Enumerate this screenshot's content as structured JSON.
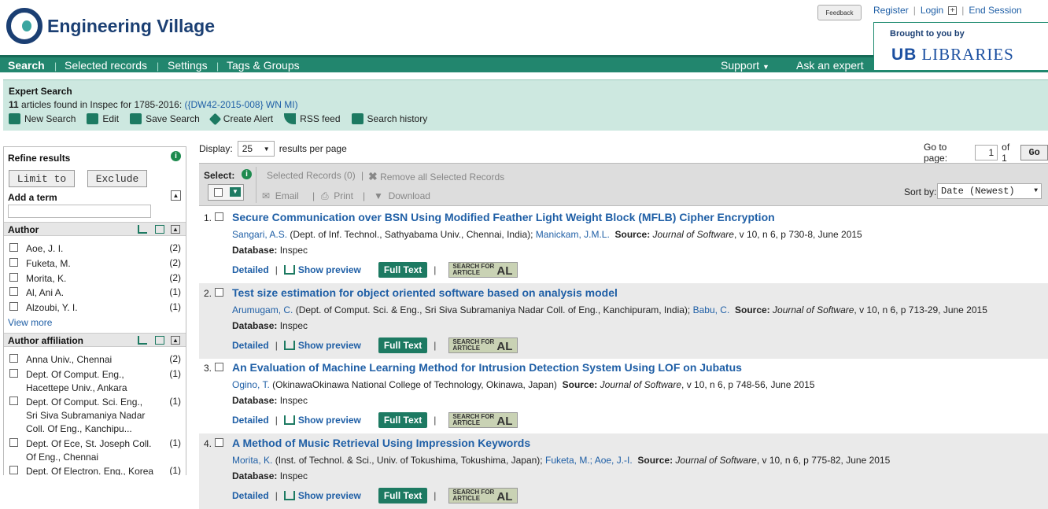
{
  "header": {
    "logo_text": "Engineering Village",
    "feedback": "Feedback",
    "links": [
      "Register",
      "Login",
      "End Session"
    ],
    "brought_by": "Brought to you by",
    "library_mark": "UB",
    "library_name": "LIBRARIES"
  },
  "nav": {
    "items": [
      "Search",
      "Selected records",
      "Settings",
      "Tags & Groups"
    ],
    "right_items": [
      "Support",
      "Ask an expert"
    ]
  },
  "expert": {
    "title": "Expert Search",
    "count": "11",
    "summary": "articles found in Inspec for 1785-2016:",
    "query": "({DW42-2015-008} WN MI)",
    "tools": [
      "New Search",
      "Edit",
      "Save Search",
      "Create Alert",
      "RSS feed",
      "Search history"
    ]
  },
  "sidebar": {
    "title": "Refine results",
    "limit_to": "Limit to",
    "exclude": "Exclude",
    "add_term": "Add a term",
    "author_heading": "Author",
    "authors": [
      {
        "name": "Aoe, J. I.",
        "count": "(2)"
      },
      {
        "name": "Fuketa, M.",
        "count": "(2)"
      },
      {
        "name": "Morita, K.",
        "count": "(2)"
      },
      {
        "name": "Al, Ani A.",
        "count": "(1)"
      },
      {
        "name": "Alzoubi, Y. I.",
        "count": "(1)"
      }
    ],
    "view_more": "View more",
    "affiliation_heading": "Author affiliation",
    "affiliations": [
      {
        "name": "Anna Univ., Chennai",
        "count": "(2)"
      },
      {
        "name": "Dept. Of Comput. Eng., Hacettepe Univ., Ankara",
        "count": "(1)"
      },
      {
        "name": "Dept. Of Comput. Sci. Eng., Sri Siva Subramaniya Nadar Coll. Of Eng., Kanchipu...",
        "count": "(1)"
      },
      {
        "name": "Dept. Of Ece, St. Joseph Coll. Of Eng., Chennai",
        "count": "(1)"
      },
      {
        "name": "Dept. Of Electron. Eng., Korea",
        "count": "(1)"
      }
    ]
  },
  "results_header": {
    "display_label": "Display:",
    "per_page": "25",
    "per_page_suffix": "results per page",
    "goto_label": "Go to page:",
    "page": "1",
    "of_pages": "of 1",
    "go": "Go",
    "select_label": "Select:",
    "selected_records": "Selected Records (0)",
    "remove_all": "Remove all Selected Records",
    "email": "Email",
    "print": "Print",
    "download": "Download",
    "sort_by": "Sort by:",
    "sort_value": "Date (Newest)"
  },
  "results": [
    {
      "num": "1.",
      "title": "Secure Communication over BSN Using Modified Feather Light Weight Block (MFLB) Cipher Encryption",
      "author1": "Sangari, A.S.",
      "aff1": "(Dept. of Inf. Technol., Sathyabama Univ., Chennai, India);",
      "author2": "Manickam, J.M.L.",
      "aff2": "",
      "author3": "",
      "source_label": "Source:",
      "journal": "Journal of Software",
      "citation": ", v 10, n 6, p 730-8, June 2015",
      "database": "Inspec"
    },
    {
      "num": "2.",
      "title": "Test size estimation for object oriented software based on analysis model",
      "author1": "Arumugam, C.",
      "aff1": "(Dept. of Comput. Sci. & Eng., Sri Siva Subramaniya Nadar Coll. of Eng., Kanchipuram, India);",
      "author2": "Babu, C.",
      "aff2": "",
      "author3": "",
      "source_label": "Source:",
      "journal": "Journal of Software",
      "citation": ", v 10, n 6, p 713-29, June 2015",
      "database": "Inspec"
    },
    {
      "num": "3.",
      "title": "An Evaluation of Machine Learning Method for Intrusion Detection System Using LOF on Jubatus",
      "author1": "Ogino, T.",
      "aff1": "(OkinawaOkinawa National College of Technology, Okinawa, Japan)",
      "author2": "",
      "aff2": "",
      "author3": "",
      "source_label": "Source:",
      "journal": "Journal of Software",
      "citation": ", v 10, n 6, p 748-56, June 2015",
      "database": "Inspec"
    },
    {
      "num": "4.",
      "title": "A Method of Music Retrieval Using Impression Keywords",
      "author1": "Morita, K.",
      "aff1": "(Inst. of Technol. & Sci., Univ. of Tokushima, Tokushima, Japan);",
      "author2": "Fuketa, M.;",
      "aff2": "",
      "author3": "Aoe, J.-I.",
      "source_label": "Source:",
      "journal": "Journal of Software",
      "citation": ", v 10, n 6, p 775-82, June 2015",
      "database": "Inspec"
    }
  ],
  "result_actions": {
    "detailed": "Detailed",
    "show_preview": "Show preview",
    "full_text": "Full Text",
    "search_for": "SEARCH FOR",
    "article": "ARTICLE",
    "al": "AL"
  },
  "labels": {
    "database": "Database:"
  }
}
